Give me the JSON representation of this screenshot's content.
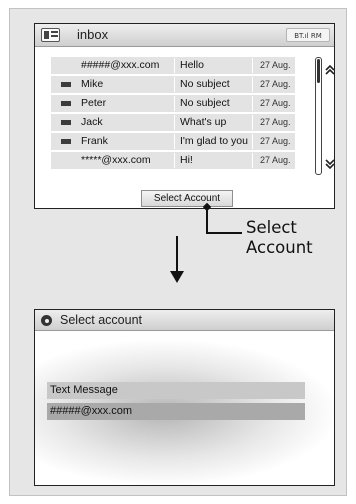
{
  "inbox": {
    "title": "inbox",
    "status": "BT.ıl RM",
    "messages": [
      {
        "sender": "#####@xxx.com",
        "subject": "Hello",
        "date": "27 Aug.",
        "has_icon": false
      },
      {
        "sender": "Mike",
        "subject": "No subject",
        "date": "27 Aug.",
        "has_icon": true
      },
      {
        "sender": "Peter",
        "subject": "No subject",
        "date": "27 Aug.",
        "has_icon": true
      },
      {
        "sender": "Jack",
        "subject": "What's up",
        "date": "27 Aug.",
        "has_icon": true
      },
      {
        "sender": "Frank",
        "subject": "I'm glad to you",
        "date": "27 Aug.",
        "has_icon": true
      },
      {
        "sender": "*****@xxx.com",
        "subject": "Hi!",
        "date": "27 Aug.",
        "has_icon": false
      }
    ],
    "select_button_label": "Select Account",
    "scroll_up": "⌃",
    "scroll_down": "⌄"
  },
  "callout": {
    "line1": "Select",
    "line2": "Account"
  },
  "select_screen": {
    "title": "Select account",
    "options": [
      "Text Message",
      "#####@xxx.com"
    ]
  }
}
